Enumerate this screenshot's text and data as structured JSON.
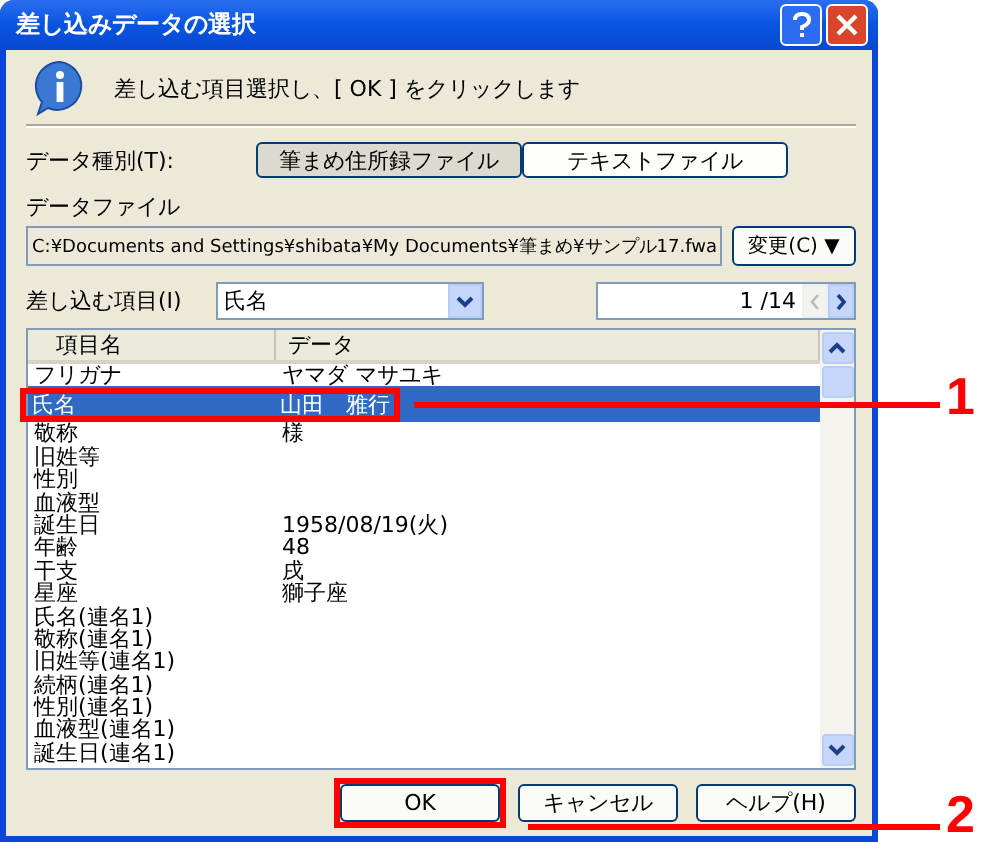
{
  "window": {
    "title": "差し込みデータの選択"
  },
  "message": "差し込む項目選択し、[ OK ] をクリックします",
  "data_kind": {
    "label": "データ種別(T):",
    "options": [
      {
        "label": "筆まめ住所録ファイル",
        "selected": true
      },
      {
        "label": "テキストファイル",
        "selected": false
      }
    ]
  },
  "data_file": {
    "label": "データファイル",
    "value": "C:¥Documents and Settings¥shibata¥My Documents¥筆まめ¥サンプル17.fwa",
    "change_button": "変更(C) ▼"
  },
  "insert_item": {
    "label": "差し込む項目(I)",
    "value": "氏名"
  },
  "pager": {
    "value": "1 /14"
  },
  "table": {
    "columns": [
      "項目名",
      "データ"
    ],
    "rows": [
      {
        "name": "フリガナ",
        "data": "ヤマダ マサユキ",
        "selected": false
      },
      {
        "name": "氏名",
        "data": "山田　雅行",
        "selected": true
      },
      {
        "name": "敬称",
        "data": "様",
        "selected": false
      },
      {
        "name": "旧姓等",
        "data": "",
        "selected": false
      },
      {
        "name": "性別",
        "data": "",
        "selected": false
      },
      {
        "name": "血液型",
        "data": "",
        "selected": false
      },
      {
        "name": "誕生日",
        "data": "1958/08/19(火)",
        "selected": false
      },
      {
        "name": "年齢",
        "data": "48",
        "selected": false
      },
      {
        "name": "干支",
        "data": "戌",
        "selected": false
      },
      {
        "name": "星座",
        "data": "獅子座",
        "selected": false
      },
      {
        "name": "氏名(連名1)",
        "data": "",
        "selected": false
      },
      {
        "name": "敬称(連名1)",
        "data": "",
        "selected": false
      },
      {
        "name": "旧姓等(連名1)",
        "data": "",
        "selected": false
      },
      {
        "name": "続柄(連名1)",
        "data": "",
        "selected": false
      },
      {
        "name": "性別(連名1)",
        "data": "",
        "selected": false
      },
      {
        "name": "血液型(連名1)",
        "data": "",
        "selected": false
      },
      {
        "name": "誕生日(連名1)",
        "data": "",
        "selected": false
      }
    ]
  },
  "buttons": [
    "OK",
    "キャンセル",
    "ヘルプ(H)"
  ],
  "callouts": [
    "1",
    "2"
  ]
}
